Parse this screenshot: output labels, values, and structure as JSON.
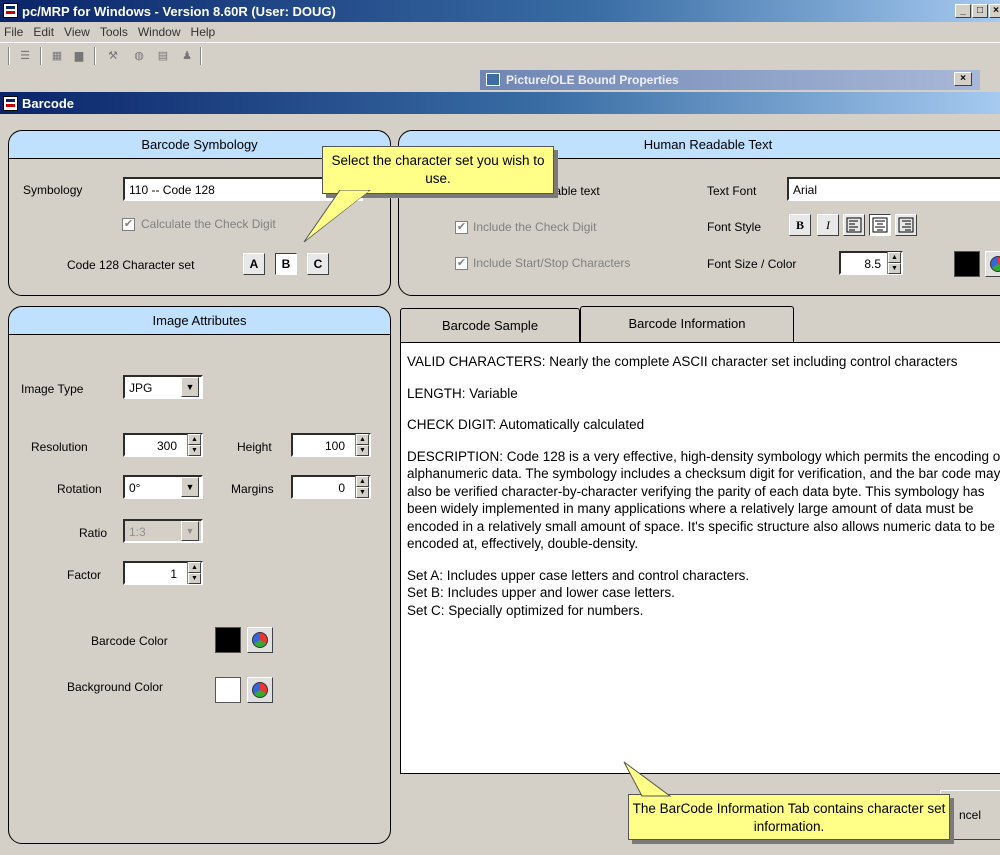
{
  "window": {
    "title": "pc/MRP for Windows - Version 8.60R  (User: DOUG)",
    "controls": [
      "_",
      "□",
      "×"
    ]
  },
  "menu": [
    "File",
    "Edit",
    "View",
    "Tools",
    "Window",
    "Help"
  ],
  "ole_window": {
    "title": "Picture/OLE Bound Properties",
    "close": "×"
  },
  "dialog": {
    "title": "Barcode"
  },
  "symbology_panel": {
    "heading": "Barcode Symbology",
    "symbology_label": "Symbology",
    "symbology_value": "110 -- Code 128",
    "check_digit_label": "Calculate the Check Digit",
    "charset_label": "Code 128 Character set",
    "charset_buttons": [
      "A",
      "B",
      "C"
    ],
    "selected_charset": "B"
  },
  "human_panel": {
    "heading": "Human Readable Text",
    "include_text_label": "adable text",
    "include_check_label": "Include the Check Digit",
    "include_startstop_label": "Include Start/Stop Characters",
    "font_label": "Text Font",
    "font_value": "Arial",
    "style_label": "Font Style",
    "style_buttons": [
      "B",
      "I"
    ],
    "size_label": "Font Size / Color",
    "size_value": "8.5",
    "text_color": "#000000"
  },
  "image_panel": {
    "heading": "Image Attributes",
    "image_type_label": "Image Type",
    "image_type_value": "JPG",
    "resolution_label": "Resolution",
    "resolution_value": "300",
    "height_label": "Height",
    "height_value": "100",
    "rotation_label": "Rotation",
    "rotation_value": "0°",
    "margins_label": "Margins",
    "margins_value": "0",
    "ratio_label": "Ratio",
    "ratio_value": "1:3",
    "factor_label": "Factor",
    "factor_value": "1",
    "barcode_color_label": "Barcode Color",
    "barcode_color": "#000000",
    "background_color_label": "Background Color",
    "background_color": "#ffffff"
  },
  "tabs": {
    "sample": "Barcode Sample",
    "information": "Barcode Information",
    "active": "information"
  },
  "info": {
    "valid": "VALID CHARACTERS:  Nearly the complete ASCII character set including control characters",
    "length": "LENGTH:  Variable",
    "check": "CHECK DIGIT:  Automatically calculated",
    "description": "DESCRIPTION:  Code 128 is a very effective, high-density symbology which permits the encoding of alphanumeric data. The symbology includes a checksum digit for verification, and the bar code may also be verified character-by-character verifying the parity of each data byte. This symbology has been widely implemented in many applications where a relatively large amount of data must be encoded in a relatively small amount of space. It's specific structure also allows numeric data to be encoded at, effectively, double-density.",
    "set_a": "Set A: Includes upper case letters and control characters.",
    "set_b": "Set B: Includes upper and lower case letters.",
    "set_c": "Set C: Specially optimized for numbers."
  },
  "cancel_label": "ncel",
  "callouts": {
    "charset": "Select the character set you wish to use.",
    "info_tab": "The BarCode Information Tab contains character set information."
  }
}
